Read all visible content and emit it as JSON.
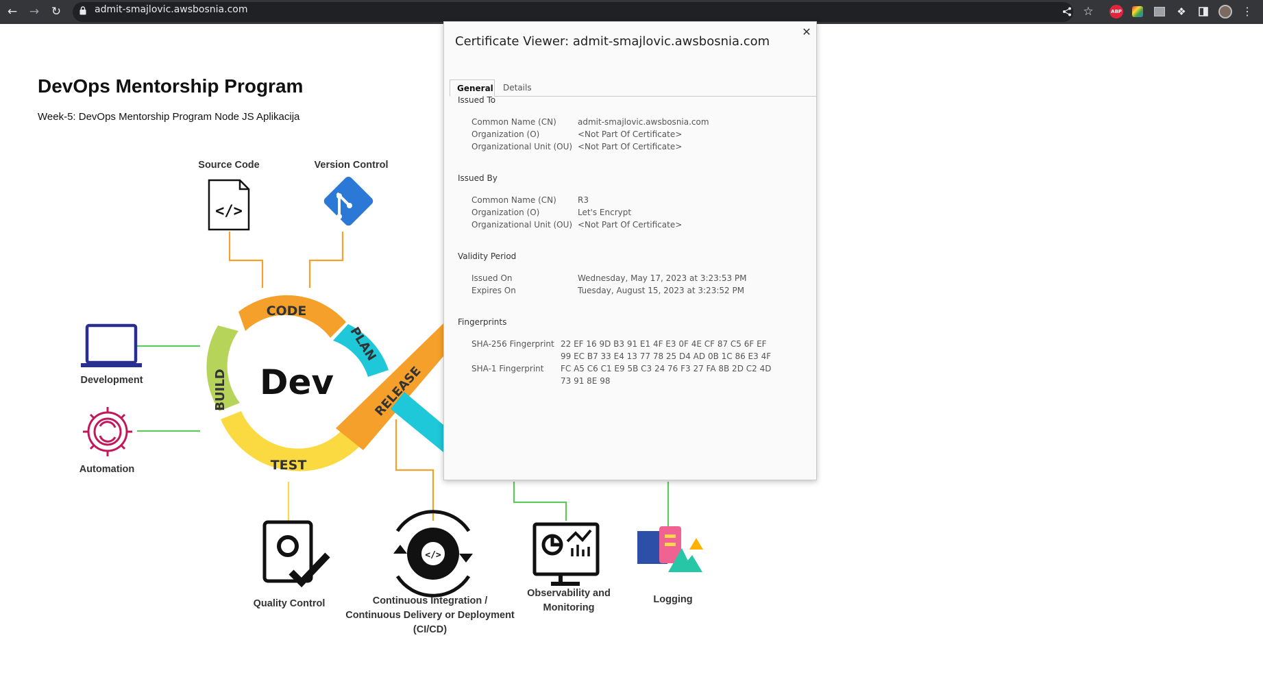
{
  "browser": {
    "url": "admit-smajlovic.awsbosnia.com",
    "extension_badge": "ABP"
  },
  "page": {
    "title": "DevOps Mentorship Program",
    "subtitle": "Week-5: DevOps Mentorship Program Node JS Aplikacija"
  },
  "diagram": {
    "labels": {
      "source_code": "Source Code",
      "version_control": "Version Control",
      "development": "Development",
      "automation": "Automation",
      "quality_control": "Quality Control",
      "cicd_line1": "Continuous Integration /",
      "cicd_line2": "Continuous Delivery or Deployment",
      "cicd_line3": "(CI/CD)",
      "observability_line1": "Observability and",
      "observability_line2": "Monitoring",
      "logging": "Logging"
    },
    "segments": {
      "code": "CODE",
      "plan": "PLAN",
      "build": "BUILD",
      "test": "TEST",
      "release": "RELEASE",
      "dev": "Dev"
    },
    "colors": {
      "orange": "#f5a02a",
      "yellow": "#fbd940",
      "green": "#b7d45a",
      "cyan": "#1ec8d8",
      "blue": "#2b78d6",
      "navy": "#2a2f8f",
      "magenta": "#c2185b"
    }
  },
  "certificate": {
    "title": "Certificate Viewer: admit-smajlovic.awsbosnia.com",
    "tabs": [
      "General",
      "Details"
    ],
    "issued_to": {
      "heading": "Issued To",
      "rows": [
        {
          "key": "Common Name (CN)",
          "value": "admit-smajlovic.awsbosnia.com"
        },
        {
          "key": "Organization (O)",
          "value": "<Not Part Of Certificate>"
        },
        {
          "key": "Organizational Unit (OU)",
          "value": "<Not Part Of Certificate>"
        }
      ]
    },
    "issued_by": {
      "heading": "Issued By",
      "rows": [
        {
          "key": "Common Name (CN)",
          "value": "R3"
        },
        {
          "key": "Organization (O)",
          "value": "Let's Encrypt"
        },
        {
          "key": "Organizational Unit (OU)",
          "value": "<Not Part Of Certificate>"
        }
      ]
    },
    "validity": {
      "heading": "Validity Period",
      "rows": [
        {
          "key": "Issued On",
          "value": "Wednesday, May 17, 2023 at 3:23:53 PM"
        },
        {
          "key": "Expires On",
          "value": "Tuesday, August 15, 2023 at 3:23:52 PM"
        }
      ]
    },
    "fingerprints": {
      "heading": "Fingerprints",
      "sha256_key": "SHA-256 Fingerprint",
      "sha256_line1": "22 EF 16 9D B3 91 E1 4F E3 0F 4E CF 87 C5 6F EF",
      "sha256_line2": "99 EC B7 33 E4 13 77 78 25 D4 AD 0B 1C 86 E3 4F",
      "sha1_key": "SHA-1 Fingerprint",
      "sha1_line1": "FC A5 C6 C1 E9 5B C3 24 76 F3 27 FA 8B 2D C2 4D",
      "sha1_line2": "73 91 8E 98"
    }
  }
}
